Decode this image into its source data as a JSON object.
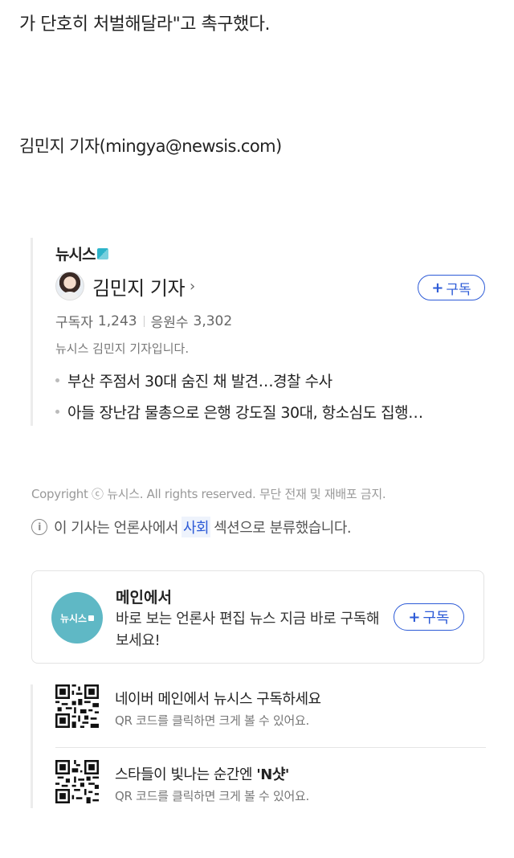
{
  "article": {
    "tail_text": "가 단호히 처벌해달라\"고 촉구했다.",
    "byline": "김민지 기자(mingya@newsis.com)"
  },
  "reporter_card": {
    "press_name": "뉴시스",
    "reporter_name": "김민지 기자",
    "chevron": "›",
    "subscribe_label": "구독",
    "subscribers_label": "구독자",
    "subscribers_count": "1,243",
    "cheers_label": "응원수",
    "cheers_count": "3,302",
    "intro": "뉴시스 김민지 기자입니다.",
    "articles": [
      "부산 주점서 30대 숨진 채 발견…경찰 수사",
      "아들 장난감 물총으로 은행 강도질 30대, 항소심도 집행…"
    ]
  },
  "footer": {
    "copyright": "Copyright ⓒ 뉴시스. All rights reserved. 무단 전재 및 재배포 금지.",
    "classify_before": "이 기사는 언론사에서",
    "classify_section": "사회",
    "classify_after": "섹션으로 분류했습니다."
  },
  "press_box": {
    "logo_text": "뉴시스",
    "title": "메인에서",
    "description": "바로 보는 언론사 편집 뉴스 지금 바로 구독해보세요!",
    "subscribe_label": "구독"
  },
  "qr_items": [
    {
      "title": "네이버 메인에서 뉴시스 구독하세요",
      "hint": "QR 코드를 클릭하면 크게 볼 수 있어요."
    },
    {
      "title_before": "스타들이 빛나는 순간엔 ",
      "title_bold": "'N샷'",
      "hint": "QR 코드를 클릭하면 크게 볼 수 있어요."
    }
  ],
  "colors": {
    "accent_blue": "#2d5bd7",
    "press_teal": "#5fb8c5"
  },
  "icons": {
    "info": "info-circle-icon",
    "plus": "plus-icon",
    "chevron": "chevron-right-icon",
    "qr": "qr-code-icon"
  }
}
